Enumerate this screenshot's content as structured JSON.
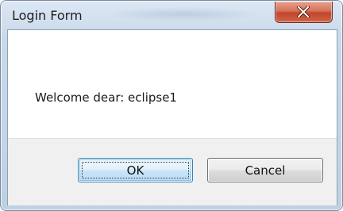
{
  "window": {
    "title": "Login Form",
    "close_icon": "close-x-icon"
  },
  "content": {
    "message": "Welcome dear: eclipse1"
  },
  "buttons": {
    "ok_label": "OK",
    "cancel_label": "Cancel"
  },
  "colors": {
    "close_button": "#c2472a",
    "ok_button_border": "#3c7fb1",
    "footer_background": "#f0f0f0"
  }
}
